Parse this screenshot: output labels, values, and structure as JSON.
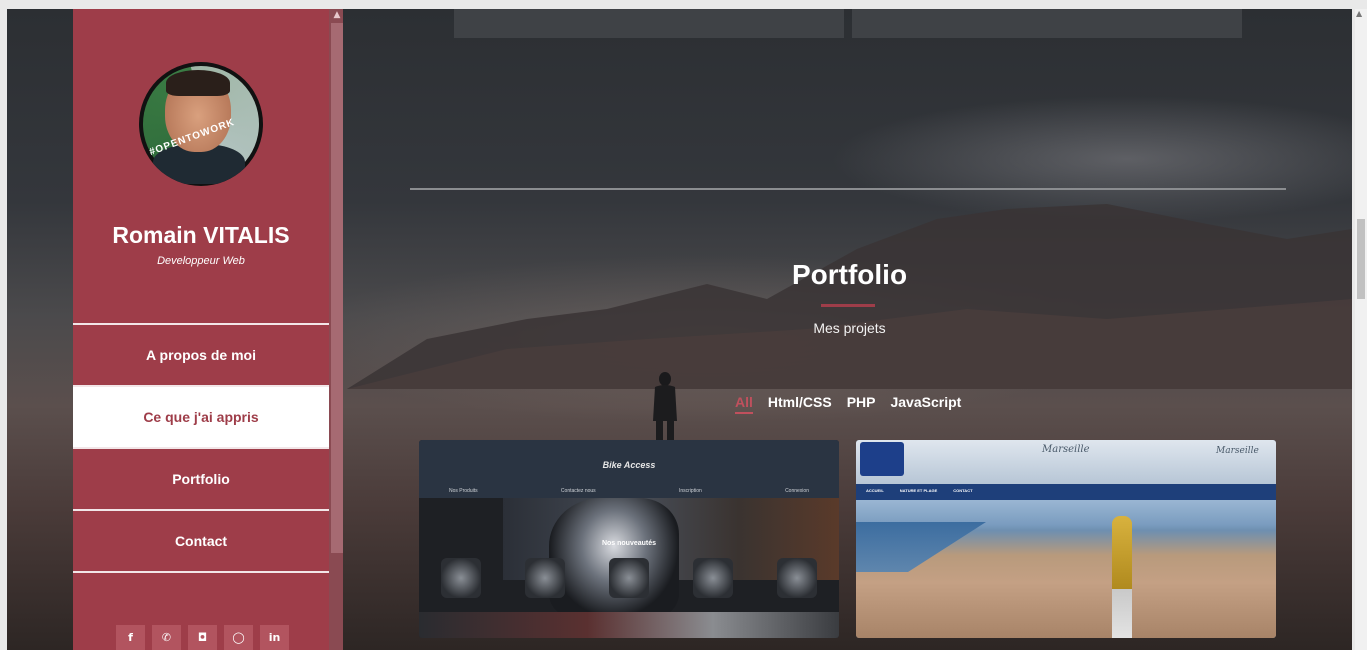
{
  "sidebar": {
    "name": "Romain VITALIS",
    "subtitle": "Developpeur Web",
    "avatar_badge": "#OPENTOWORK",
    "nav": [
      {
        "label": "A propos de moi",
        "active": false
      },
      {
        "label": "Ce que j'ai appris",
        "active": true
      },
      {
        "label": "Portfolio",
        "active": false
      },
      {
        "label": "Contact",
        "active": false
      }
    ],
    "social": [
      {
        "icon": "facebook-icon",
        "glyph": "f"
      },
      {
        "icon": "phone-icon",
        "glyph": "✆"
      },
      {
        "icon": "instagram-icon",
        "glyph": "◘"
      },
      {
        "icon": "github-icon",
        "glyph": "◯"
      },
      {
        "icon": "linkedin-icon",
        "glyph": "in"
      }
    ]
  },
  "section": {
    "title": "Portfolio",
    "subtitle": "Mes projets",
    "filters": [
      {
        "label": "All",
        "active": true
      },
      {
        "label": "Html/CSS",
        "active": false
      },
      {
        "label": "PHP",
        "active": false
      },
      {
        "label": "JavaScript",
        "active": false
      }
    ]
  },
  "projects": [
    {
      "logo": "Bike Access",
      "menu": [
        "Nos Produits",
        "Contactez nous",
        "Inscription",
        "Connexion"
      ],
      "banner": "Nos nouveautés"
    },
    {
      "script_left": "Marseille",
      "script_right": "Marseille",
      "menu": [
        "ACCUEIL",
        "NATURE ET PLAGE",
        "CONTACT"
      ]
    }
  ],
  "colors": {
    "accent": "#9e3d49",
    "active_filter": "#c0505d"
  }
}
